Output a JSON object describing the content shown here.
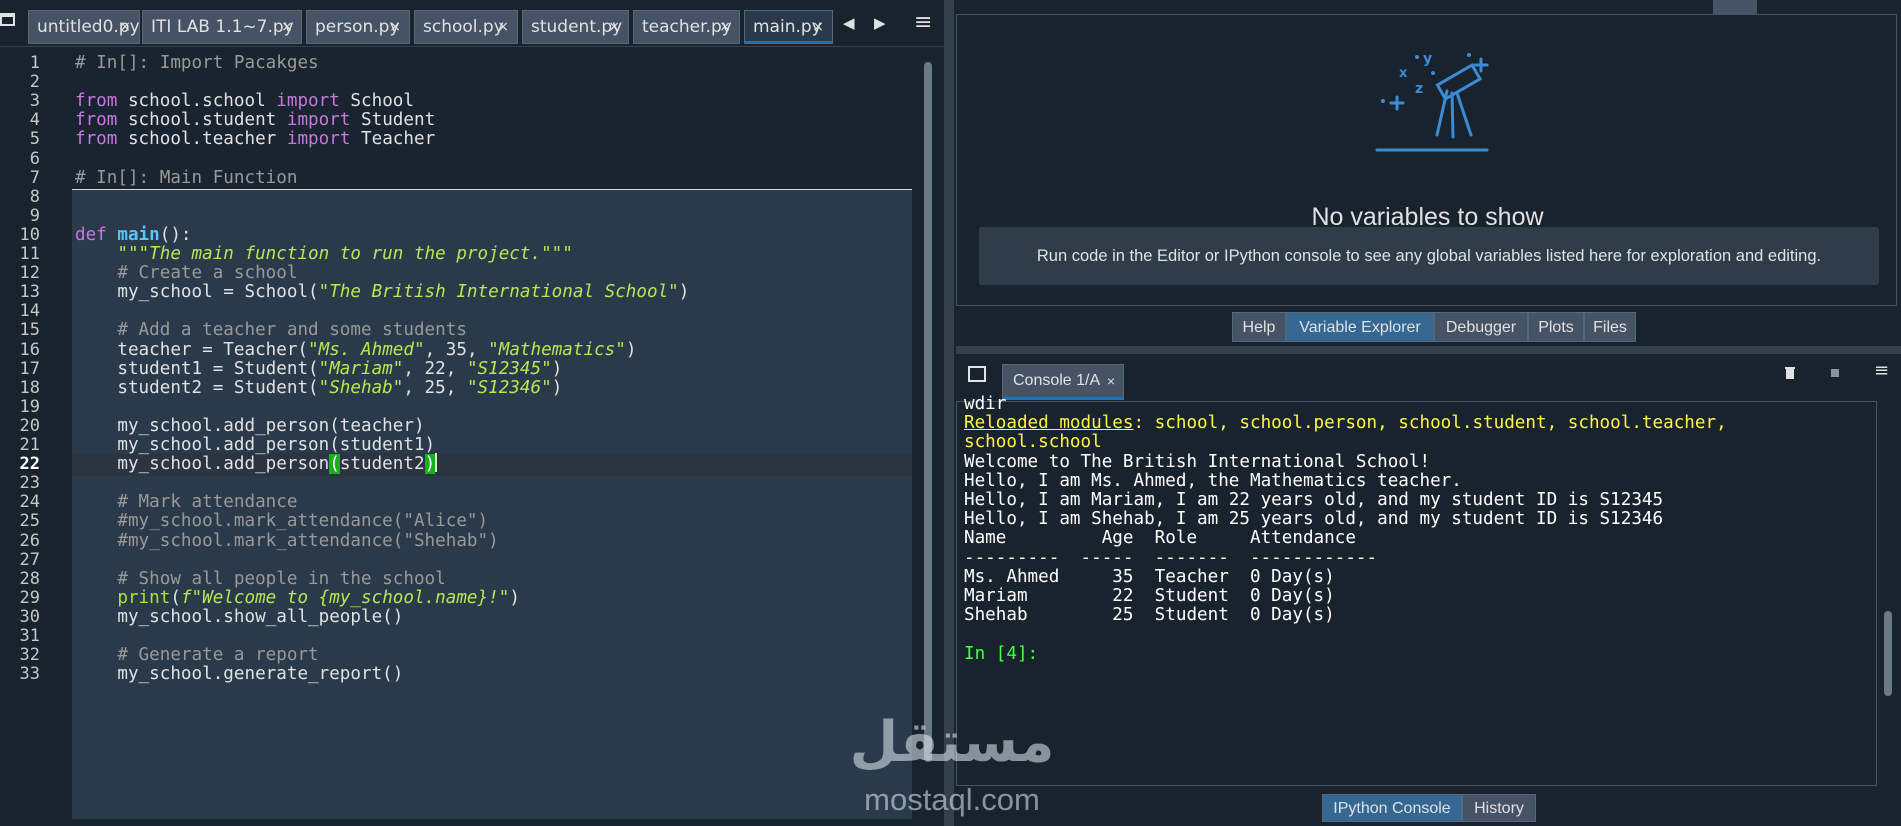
{
  "editor": {
    "tabs": [
      {
        "label": "untitled0.py",
        "active": false
      },
      {
        "label": "ITI LAB 1.1~7.py",
        "active": false
      },
      {
        "label": "person.py",
        "active": false
      },
      {
        "label": "school.py",
        "active": false
      },
      {
        "label": "student.py",
        "active": false
      },
      {
        "label": "teacher.py",
        "active": false
      },
      {
        "label": "main.py",
        "active": true
      }
    ],
    "close_glyph": "×",
    "current_line": 22,
    "lines": [
      "# In[]: Import Pacakges",
      "",
      "from school.school import School",
      "from school.student import Student",
      "from school.teacher import Teacher",
      "",
      "# In[]: Main Function",
      "",
      "",
      "def main():",
      "    \"\"\"The main function to run the project.\"\"\"",
      "    # Create a school",
      "    my_school = School(\"The British International School\")",
      "",
      "    # Add a teacher and some students",
      "    teacher = Teacher(\"Ms. Ahmed\", 35, \"Mathematics\")",
      "    student1 = Student(\"Mariam\", 22, \"S12345\")",
      "    student2 = Student(\"Shehab\", 25, \"S12346\")",
      "",
      "    my_school.add_person(teacher)",
      "    my_school.add_person(student1)",
      "    my_school.add_person(student2)",
      "",
      "    # Mark attendance",
      "    #my_school.mark_attendance(\"Alice\")",
      "    #my_school.mark_attendance(\"Shehab\")",
      "",
      "    # Show all people in the school",
      "    print(f\"Welcome to {my_school.name}!\")",
      "    my_school.show_all_people()",
      "",
      "    # Generate a report",
      "    my_school.generate_report()"
    ]
  },
  "variable_explorer": {
    "title": "No variables to show",
    "message": "Run code in the Editor or IPython console to see any global variables listed here for exploration and editing.",
    "tabs": [
      "Help",
      "Variable Explorer",
      "Debugger",
      "Plots",
      "Files"
    ],
    "active_tab": "Variable Explorer"
  },
  "console": {
    "tab_label": "Console 1/A",
    "output": [
      {
        "text": "wdir",
        "style": "plain"
      },
      {
        "parts": [
          {
            "text": "Reloaded modules",
            "style": "link"
          },
          {
            "text": ": school, school.person, school.student, school.teacher,",
            "style": "yellow"
          }
        ]
      },
      {
        "text": "school.school",
        "style": "yellow"
      },
      {
        "text": "Welcome to The British International School!",
        "style": "plain"
      },
      {
        "text": "Hello, I am Ms. Ahmed, the Mathematics teacher.",
        "style": "plain"
      },
      {
        "text": "Hello, I am Mariam, I am 22 years old, and my student ID is S12345",
        "style": "plain"
      },
      {
        "text": "Hello, I am Shehab, I am 25 years old, and my student ID is S12346",
        "style": "plain"
      },
      {
        "text": "Name         Age  Role     Attendance",
        "style": "plain"
      },
      {
        "text": "---------  -----  -------  ------------",
        "style": "plain"
      },
      {
        "text": "Ms. Ahmed     35  Teacher  0 Day(s)",
        "style": "plain"
      },
      {
        "text": "Mariam        22  Student  0 Day(s)",
        "style": "plain"
      },
      {
        "text": "Shehab        25  Student  0 Day(s)",
        "style": "plain"
      },
      {
        "text": "",
        "style": "plain"
      },
      {
        "text": "In [4]:",
        "style": "green"
      }
    ],
    "bottom_tabs": [
      "IPython Console",
      "History"
    ],
    "active_bottom_tab": "IPython Console"
  },
  "watermark": {
    "arabic": "مستقل",
    "latin": "mostaql.com"
  },
  "icons": {
    "pane_menu": "window-icon",
    "tab_options": "hamburger-menu-icon",
    "telescope": "telescope-icon"
  },
  "colors": {
    "background": "#19232d",
    "accent": "#1a72bb",
    "comment": "#999999",
    "keyword": "#c678dd",
    "string": "#b5e853",
    "function": "#57c7ff",
    "console_yellow": "#fff542",
    "console_green": "#44ff44"
  }
}
